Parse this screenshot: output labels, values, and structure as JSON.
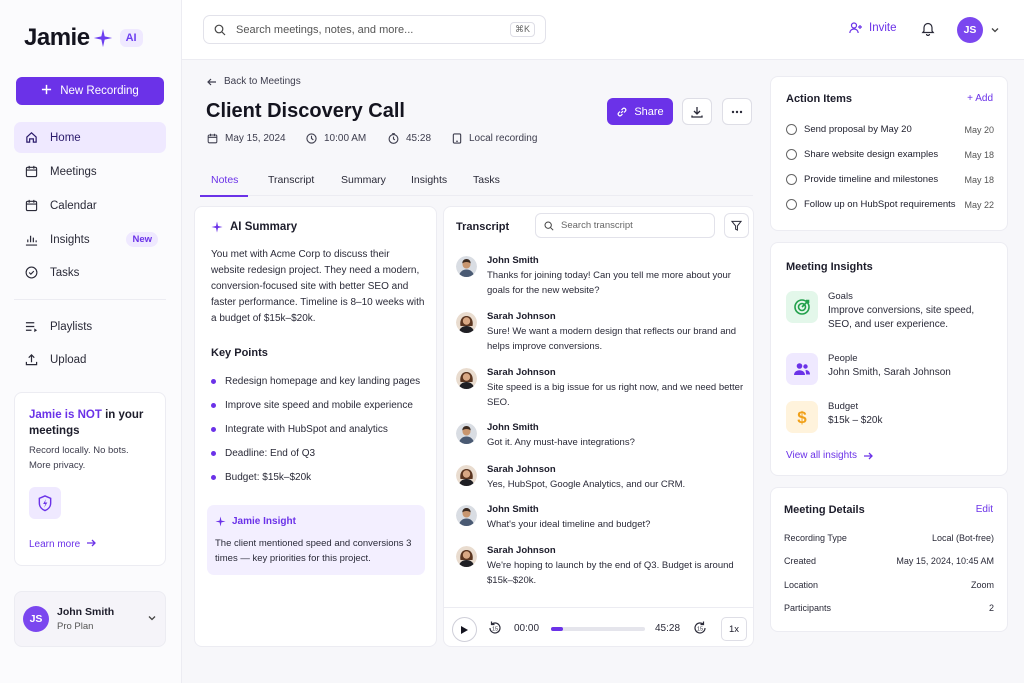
{
  "sidebar": {
    "logo": "Jamie",
    "logo_badge": "AI",
    "new_recording": "New Recording",
    "nav": [
      {
        "label": "Home",
        "icon": "home-icon"
      },
      {
        "label": "Meetings",
        "icon": "calendar-icon"
      },
      {
        "label": "Calendar",
        "icon": "calendar-icon"
      },
      {
        "label": "Insights",
        "icon": "insights-icon",
        "badge": "New"
      },
      {
        "label": "Tasks",
        "icon": "check-circle-icon"
      },
      {
        "label": "Playlists",
        "icon": "playlist-icon"
      },
      {
        "label": "Upload",
        "icon": "upload-icon"
      }
    ],
    "promo": {
      "title_highlight": "Jamie is NOT",
      "title_rest": " in your meetings",
      "line1": "Record locally. No bots.",
      "line2": "More privacy.",
      "learn_more": "Learn more"
    },
    "user": {
      "initials": "JS",
      "name": "John Smith",
      "plan": "Pro Plan"
    }
  },
  "topbar": {
    "search_placeholder": "Search meetings, notes, and more...",
    "shortcut": "⌘K",
    "invite": "Invite",
    "avatar_initials": "JS"
  },
  "meeting": {
    "back": "Back to Meetings",
    "title": "Client Discovery Call",
    "date": "May 15, 2024",
    "time": "10:00 AM",
    "duration": "45:28",
    "source": "Local recording",
    "share": "Share",
    "tabs": [
      "Notes",
      "Transcript",
      "Summary",
      "Insights",
      "Tasks"
    ]
  },
  "notes": {
    "ai_summary_title": "AI Summary",
    "summary": "You met with Acme Corp to discuss their website redesign project. They need a modern, conversion-focused site with better SEO and faster performance. Timeline is 8–10 weeks with a budget of $15k–$20k.",
    "key_points_title": "Key Points",
    "key_points": [
      "Redesign homepage and key landing pages",
      "Improve site speed and mobile experience",
      "Integrate with HubSpot and analytics",
      "Deadline: End of Q3",
      "Budget: $15k–$20k"
    ],
    "insight_title": "Jamie Insight",
    "insight_text": "The client mentioned speed and conversions 3 times — key priorities for this project."
  },
  "transcript": {
    "title": "Transcript",
    "search_placeholder": "Search transcript",
    "messages": [
      {
        "speaker": "John Smith",
        "text": "Thanks for joining today! Can you tell me more about your goals for the new website?"
      },
      {
        "speaker": "Sarah Johnson",
        "text": "Sure! We want a modern design that reflects our brand and helps improve conversions."
      },
      {
        "speaker": "Sarah Johnson",
        "text": "Site speed is a big issue for us right now, and we need better SEO."
      },
      {
        "speaker": "John Smith",
        "text": "Got it. Any must-have integrations?"
      },
      {
        "speaker": "Sarah Johnson",
        "text": "Yes, HubSpot, Google Analytics, and our CRM."
      },
      {
        "speaker": "John Smith",
        "text": "What's your ideal timeline and budget?"
      },
      {
        "speaker": "Sarah Johnson",
        "text": "We're hoping to launch by the end of Q3. Budget is around $15k–$20k."
      }
    ],
    "player": {
      "current": "00:00",
      "total": "45:28",
      "speed": "1x",
      "progress": 0.13,
      "skip_back": "15",
      "skip_fwd": "15"
    }
  },
  "action_items": {
    "title": "Action Items",
    "add": "+ Add",
    "items": [
      {
        "text": "Send proposal by May 20",
        "due": "May 20"
      },
      {
        "text": "Share website design examples",
        "due": "May 18"
      },
      {
        "text": "Provide timeline and milestones",
        "due": "May 18"
      },
      {
        "text": "Follow up on HubSpot requirements",
        "due": "May 22"
      }
    ]
  },
  "meeting_insights": {
    "title": "Meeting Insights",
    "goals_label": "Goals",
    "goals_value": "Improve conversions, site speed, SEO, and user experience.",
    "people_label": "People",
    "people_value": "John Smith, Sarah Johnson",
    "budget_label": "Budget",
    "budget_value": "$15k – $20k",
    "view_all": "View all insights"
  },
  "meeting_details": {
    "title": "Meeting Details",
    "edit": "Edit",
    "rows": [
      {
        "k": "Recording Type",
        "v": "Local (Bot-free)"
      },
      {
        "k": "Created",
        "v": "May 15, 2024, 10:45 AM"
      },
      {
        "k": "Location",
        "v": "Zoom"
      },
      {
        "k": "Participants",
        "v": "2"
      }
    ]
  },
  "colors": {
    "accent": "#6b32e8",
    "accent_light": "#efe9ff"
  }
}
